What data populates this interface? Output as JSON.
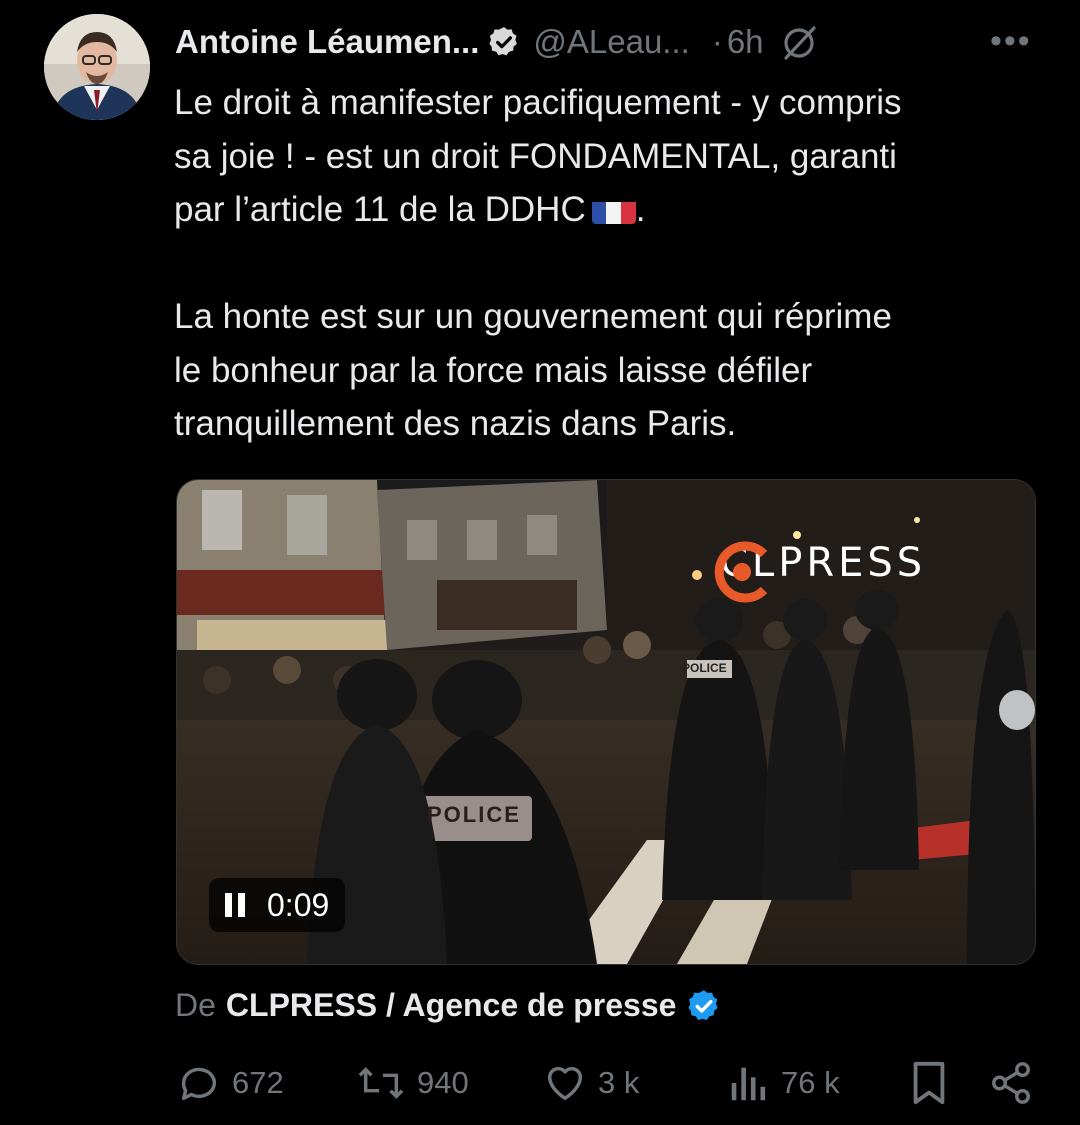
{
  "author": {
    "name": "Antoine Léaumen...",
    "handle": "@ALeau...",
    "separator": "·",
    "time": "6h"
  },
  "tweet": {
    "text": "Le droit à manifester pacifiquement - y compris\nsa joie ! - est un droit FONDAMENTAL, garanti\npar l’article 11 de la DDHC",
    "text_end": ".",
    "text2": "La honte est sur un gouvernement qui réprime\nle bonheur par la force mais laisse défiler\ntranquillement des nazis dans Paris."
  },
  "media": {
    "watermark": "CLPRESS",
    "patch_left": "POLICE",
    "patch_right": "POLICE",
    "player_time": "0:09",
    "state": "playing"
  },
  "source": {
    "prefix": "De",
    "org": "CLPRESS / Agence de presse"
  },
  "actions": {
    "replies": "672",
    "reposts": "940",
    "likes": "3 k",
    "views": "76 k"
  },
  "colors": {
    "background": "#000000",
    "text": "#e7e9ea",
    "muted": "#71767b",
    "verified": "#1d9bf0",
    "watermark": "#e85a2a"
  },
  "icons": [
    "verified-badge-icon",
    "grok-icon",
    "more-icon",
    "pause-icon",
    "reply-icon",
    "repost-icon",
    "like-icon",
    "views-icon",
    "bookmark-icon",
    "share-icon",
    "france-flag-icon"
  ]
}
